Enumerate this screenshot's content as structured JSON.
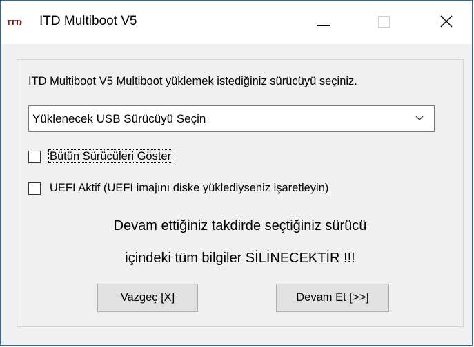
{
  "window": {
    "app_icon_text": "ITD",
    "title": "ITD Multiboot V5"
  },
  "content": {
    "instruction": "ITD Multiboot V5 Multiboot yüklemek istediğiniz sürücüyü seçiniz.",
    "drive_select": {
      "selected": "Yüklenecek USB Sürücüyü Seçin"
    },
    "show_all_drives": {
      "label": "Bütün Sürücüleri Göster",
      "checked": false
    },
    "uefi_active": {
      "label": "UEFI Aktif (UEFI imajını diske yüklediyseniz işaretleyin)",
      "checked": false
    },
    "warning_line1": "Devam ettiğiniz takdirde seçtiğiniz sürücü",
    "warning_line2": "içindeki tüm bilgiler SİLİNECEKTİR !!!",
    "cancel_button": "Vazgeç [X]",
    "continue_button": "Devam Et [>>]"
  },
  "colors": {
    "window_border": "#1e6bb8",
    "app_icon": "#7a1a14",
    "button_bg": "#e1e1e1"
  }
}
